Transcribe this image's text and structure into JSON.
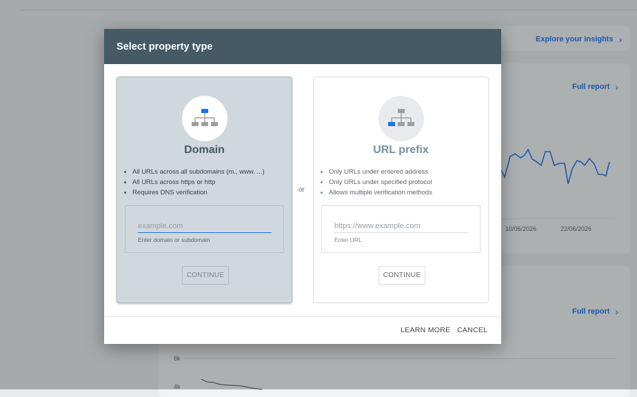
{
  "background": {
    "insights_link": "Explore your insights",
    "full_report_1": "Full report",
    "full_report_2": "Full report",
    "x_ticks": [
      "10/06/2026",
      "22/06/2026"
    ],
    "y_ticks": [
      "6k",
      "4k"
    ]
  },
  "dialog": {
    "title": "Select property type",
    "or_label": "or",
    "domain": {
      "title": "Domain",
      "features": [
        "All URLs across all subdomains (m., www. ...)",
        "All URLs across https or http",
        "Requires DNS verification"
      ],
      "input_placeholder": "example.com",
      "input_value": "",
      "hint": "Enter domain or subdomain",
      "continue_label": "CONTINUE",
      "icon": "sitemap-icon",
      "accent": "#1a73e8"
    },
    "url_prefix": {
      "title": "URL prefix",
      "features": [
        "Only URLs under entered address",
        "Only URLs under specified protocol",
        "Allows multiple verification methods"
      ],
      "input_placeholder": "https://www.example.com",
      "input_value": "",
      "hint": "Enter URL",
      "continue_label": "CONTINUE",
      "icon": "sitemap-icon",
      "accent": "#1a73e8"
    },
    "footer": {
      "learn_more": "LEARN MORE",
      "cancel": "CANCEL"
    },
    "colors": {
      "header_bg": "#455a64",
      "selected_card_bg": "#cfd8dc"
    }
  }
}
